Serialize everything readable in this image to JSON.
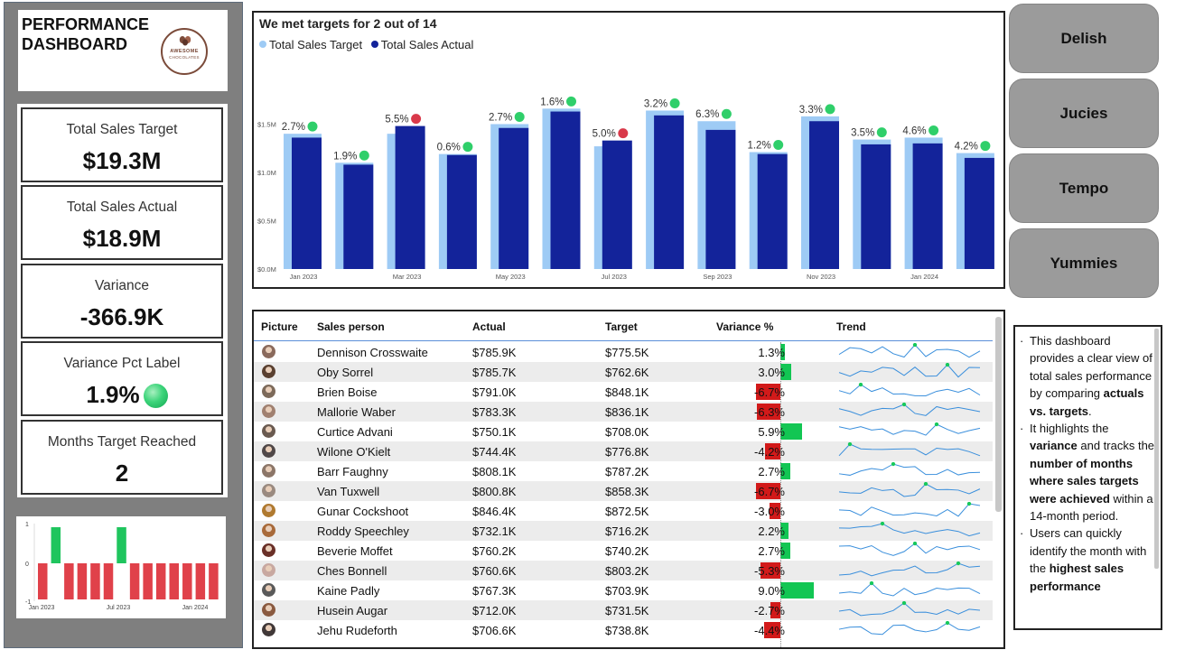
{
  "title": "PERFORMANCE\nDASHBOARD",
  "logo": {
    "line1": "AWESOME",
    "line2": "CHOCOLATES"
  },
  "kpis": [
    {
      "label": "Total Sales Target",
      "value": "$19.3M"
    },
    {
      "label": "Total Sales Actual",
      "value": "$18.9M"
    },
    {
      "label": "Variance",
      "value": "-366.9K"
    },
    {
      "label": "Variance Pct Label",
      "value": "1.9%",
      "status": "green"
    },
    {
      "label": "Months Target Reached",
      "value": "2"
    }
  ],
  "mini_chart": {
    "type": "bar",
    "y_ticks": [
      "1",
      "0",
      "-1"
    ],
    "x_ticks": [
      "Jan 2023",
      "Jul 2023",
      "Jan 2024"
    ],
    "values": [
      -1,
      1,
      -1,
      -1,
      -1,
      -1,
      1,
      -1,
      -1,
      -1,
      -1,
      -1,
      -1,
      -1
    ],
    "colors": {
      "hit": "#1fc55e",
      "miss": "#e0414a"
    }
  },
  "chart_data": {
    "type": "bar",
    "title": "We met targets for 2 out of 14",
    "legend": [
      "Total Sales Target",
      "Total Sales Actual"
    ],
    "categories": [
      "Jan 2023",
      "Feb 2023",
      "Mar 2023",
      "Apr 2023",
      "May 2023",
      "Jun 2023",
      "Jul 2023",
      "Aug 2023",
      "Sep 2023",
      "Oct 2023",
      "Nov 2023",
      "Dec 2023",
      "Jan 2024",
      "Feb 2024"
    ],
    "x_tick_labels": [
      "Jan 2023",
      "",
      "Mar 2023",
      "",
      "May 2023",
      "",
      "Jul 2023",
      "",
      "Sep 2023",
      "",
      "Nov 2023",
      "",
      "Jan 2024",
      ""
    ],
    "y_ticks": [
      "$0.0M",
      "$0.5M",
      "$1.0M",
      "$1.5M"
    ],
    "ylim": [
      0,
      1.85
    ],
    "series": [
      {
        "name": "Total Sales Target",
        "color": "#9ecbf5",
        "values": [
          1.4,
          1.1,
          1.4,
          1.19,
          1.5,
          1.66,
          1.27,
          1.64,
          1.53,
          1.21,
          1.58,
          1.34,
          1.36,
          1.2
        ]
      },
      {
        "name": "Total Sales Actual",
        "color": "#13239a",
        "values": [
          1.36,
          1.08,
          1.48,
          1.18,
          1.46,
          1.63,
          1.33,
          1.59,
          1.44,
          1.19,
          1.53,
          1.29,
          1.3,
          1.15
        ]
      }
    ],
    "variance_labels": [
      "2.7%",
      "1.9%",
      "5.5%",
      "0.6%",
      "2.7%",
      "1.6%",
      "5.0%",
      "3.2%",
      "6.3%",
      "1.2%",
      "3.3%",
      "3.5%",
      "4.6%",
      "4.2%"
    ],
    "status": [
      "green",
      "green",
      "red",
      "green",
      "green",
      "green",
      "red",
      "green",
      "green",
      "green",
      "green",
      "green",
      "green",
      "green"
    ]
  },
  "buttons": [
    "Delish",
    "Jucies",
    "Tempo",
    "Yummies"
  ],
  "table": {
    "columns": [
      "Picture",
      "Sales person",
      "Actual",
      "Target",
      "Variance %",
      "Trend"
    ],
    "rows": [
      {
        "name": "Dennison Crosswaite",
        "actual": "$785.9K",
        "target": "$775.5K",
        "var": "1.3%",
        "pct": 1.3,
        "av": "#8a6a5c"
      },
      {
        "name": "Oby Sorrel",
        "actual": "$785.7K",
        "target": "$762.6K",
        "var": "3.0%",
        "pct": 3.0,
        "av": "#5a4030"
      },
      {
        "name": "Brien Boise",
        "actual": "$791.0K",
        "target": "$848.1K",
        "var": "-6.7%",
        "pct": -6.7,
        "av": "#7d6a5a"
      },
      {
        "name": "Mallorie Waber",
        "actual": "$783.3K",
        "target": "$836.1K",
        "var": "-6.3%",
        "pct": -6.3,
        "av": "#a08070"
      },
      {
        "name": "Curtice Advani",
        "actual": "$750.1K",
        "target": "$708.0K",
        "var": "5.9%",
        "pct": 5.9,
        "av": "#6a5a50"
      },
      {
        "name": "Wilone O'Kielt",
        "actual": "$744.4K",
        "target": "$776.8K",
        "var": "-4.2%",
        "pct": -4.2,
        "av": "#504848"
      },
      {
        "name": "Barr Faughny",
        "actual": "$808.1K",
        "target": "$787.2K",
        "var": "2.7%",
        "pct": 2.7,
        "av": "#8c7668"
      },
      {
        "name": "Van Tuxwell",
        "actual": "$800.8K",
        "target": "$858.3K",
        "var": "-6.7%",
        "pct": -6.7,
        "av": "#9a8a80"
      },
      {
        "name": "Gunar Cockshoot",
        "actual": "$846.4K",
        "target": "$872.5K",
        "var": "-3.0%",
        "pct": -3.0,
        "av": "#b07a30"
      },
      {
        "name": "Roddy Speechley",
        "actual": "$732.1K",
        "target": "$716.2K",
        "var": "2.2%",
        "pct": 2.2,
        "av": "#a86a3a"
      },
      {
        "name": "Beverie Moffet",
        "actual": "$760.2K",
        "target": "$740.2K",
        "var": "2.7%",
        "pct": 2.7,
        "av": "#6a3028"
      },
      {
        "name": "Ches Bonnell",
        "actual": "$760.6K",
        "target": "$803.2K",
        "var": "-5.3%",
        "pct": -5.3,
        "av": "#c8a8a0"
      },
      {
        "name": "Kaine Padly",
        "actual": "$767.3K",
        "target": "$703.9K",
        "var": "9.0%",
        "pct": 9.0,
        "av": "#5a5a5a"
      },
      {
        "name": "Husein Augar",
        "actual": "$712.0K",
        "target": "$731.5K",
        "var": "-2.7%",
        "pct": -2.7,
        "av": "#8a5a40"
      },
      {
        "name": "Jehu Rudeforth",
        "actual": "$706.6K",
        "target": "$738.8K",
        "var": "-4.4%",
        "pct": -4.4,
        "av": "#403838"
      }
    ]
  },
  "note": [
    [
      {
        "t": "This dashboard provides a clear view of total sales performance by comparing "
      },
      {
        "t": "actuals vs. targets",
        "b": true
      },
      {
        "t": "."
      }
    ],
    [
      {
        "t": "It highlights the "
      },
      {
        "t": "variance",
        "b": true
      },
      {
        "t": " and tracks the "
      },
      {
        "t": "number of months where sales targets were achieved",
        "b": true
      },
      {
        "t": " within a 14-month period."
      }
    ],
    [
      {
        "t": "Users can quickly identify the month with the "
      },
      {
        "t": "highest sales performance",
        "b": true
      }
    ]
  ]
}
